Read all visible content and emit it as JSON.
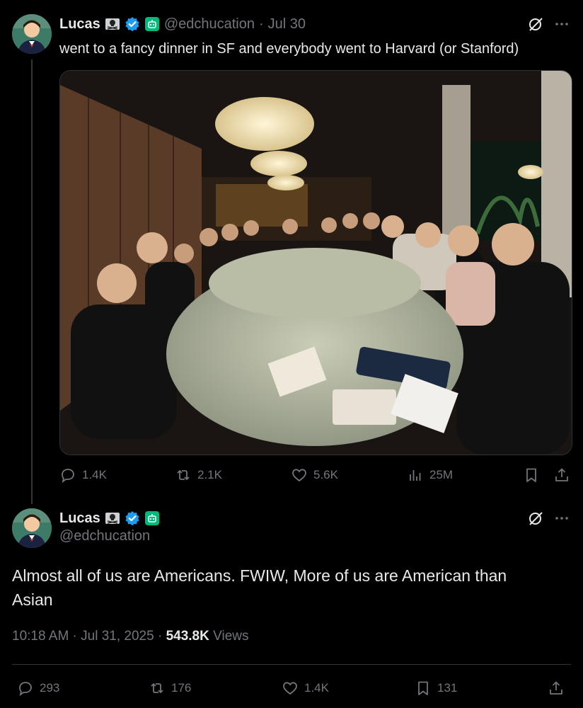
{
  "tweet1": {
    "name": "Lucas",
    "handle": "@edchucation",
    "sep": "·",
    "date": "Jul 30",
    "text": "went to a fancy dinner in SF and everybody went to Harvard (or Stanford)",
    "photo_description": "Group dinner photo",
    "actions": {
      "replies": "1.4K",
      "reposts": "2.1K",
      "likes": "5.6K",
      "views": "25M"
    }
  },
  "tweet2": {
    "name": "Lucas",
    "handle": "@edchucation",
    "text": "Almost all of us are Americans. FWIW, More of us are American than Asian",
    "time": "10:18 AM · Jul 31, 2025 ·",
    "views_count": "543.8K",
    "views_label": "Views",
    "actions": {
      "replies": "293",
      "reposts": "176",
      "likes": "1.4K",
      "bookmarks": "131"
    }
  },
  "colors": {
    "bg": "#000000",
    "text": "#e7e9ea",
    "muted": "#71767b",
    "verified": "#1d9bf0",
    "bot_badge": "#00ba7c"
  }
}
